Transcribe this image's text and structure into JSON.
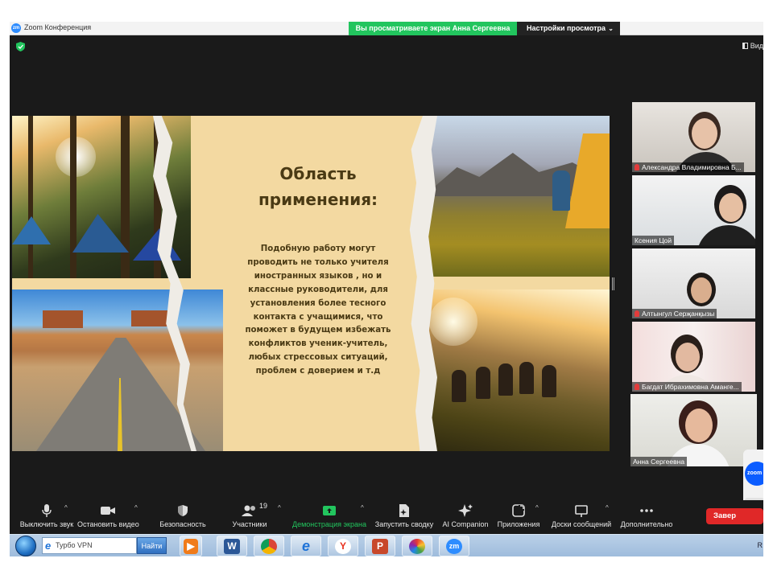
{
  "window": {
    "app_title": "Zoom Конференция",
    "logo_text": "zm",
    "share_banner": "Вы просматриваете экран Анна Сергеевна",
    "view_settings": "Настройки просмотра",
    "view_label": "Вид"
  },
  "slide": {
    "title_line1": "Область",
    "title_line2": "применения:",
    "body_lines": [
      "Подобную работу могут",
      "проводить не только учителя",
      "иностранных языков , но и",
      "классные руководители, для",
      "установления более тесного",
      "контакта с учащимися, что",
      "поможет в будущем избежать",
      "конфликтов ученик-учитель,",
      "любых стрессовых ситуаций,",
      "проблем с доверием и т.д"
    ]
  },
  "participants": [
    {
      "name": "Александра Владимировна Б...",
      "muted": true
    },
    {
      "name": "Ксения Цой",
      "muted": false
    },
    {
      "name": "Алтынгул Серҗанқызы",
      "muted": true
    },
    {
      "name": "Багдат Ибрахимовна Аманге...",
      "muted": true
    },
    {
      "name": "Анна Сергеевна",
      "muted": false,
      "active": true
    }
  ],
  "zoom_popup": {
    "logo_text": "zoom"
  },
  "toolbar": {
    "mute": "Выключить звук",
    "video": "Остановить видео",
    "security": "Безопасность",
    "participants": "Участники",
    "participants_count": "19",
    "share": "Демонстрация экрана",
    "summary": "Запустить сводку",
    "ai": "AI Companion",
    "apps": "Приложения",
    "whiteboards": "Доски сообщений",
    "more": "Дополнительно",
    "end": "Завер"
  },
  "taskbar": {
    "search_placeholder": "Турбо VPN",
    "search_button": "Найти",
    "apps": [
      "video",
      "word",
      "chrome",
      "ie",
      "yandex",
      "powerpoint",
      "photos",
      "zoom"
    ],
    "word_glyph": "W",
    "yandex_glyph": "Y",
    "ppt_glyph": "P",
    "zoom_glyph": "zm",
    "tray_text": "R"
  },
  "colors": {
    "share_green": "#22c55e",
    "end_red": "#e02828",
    "slide_beige": "#f3d9a1",
    "active_speaker": "#c8e36b"
  }
}
